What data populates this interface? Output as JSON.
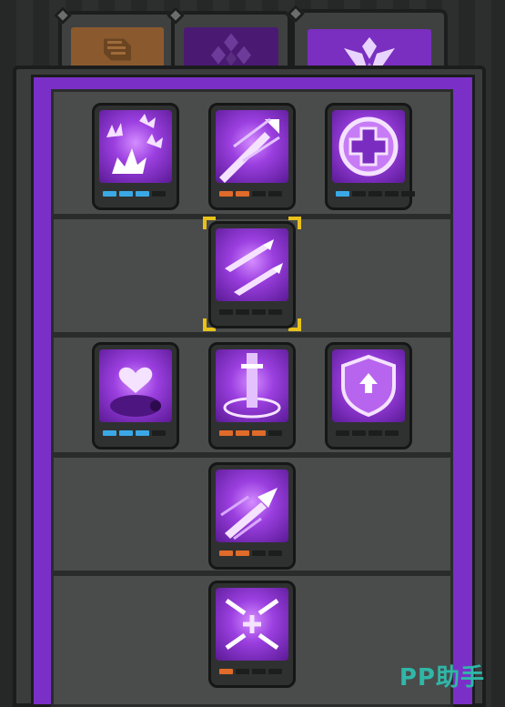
{
  "tabs": [
    {
      "icon": "scroll-icon",
      "color": "#8a5a2e",
      "active": false
    },
    {
      "icon": "diamond-cluster-icon",
      "color": "#4a1a73",
      "active": false
    },
    {
      "icon": "crest-icon",
      "color": "#7a2fc0",
      "active": true
    }
  ],
  "skills": [
    {
      "icon": "burst-spikes-icon",
      "pips": [
        "blue",
        "blue",
        "blue",
        "off"
      ]
    },
    {
      "icon": "piercing-arrow-icon",
      "pips": [
        "orange",
        "orange",
        "off",
        "off"
      ]
    },
    {
      "icon": "heal-cross-icon",
      "pips": [
        "blue",
        "off",
        "off",
        "off",
        "off"
      ]
    },
    {
      "icon": "twin-blades-icon",
      "pips": [
        "off",
        "off",
        "off",
        "off"
      ],
      "selected": true
    },
    {
      "icon": "heart-boar-icon",
      "pips": [
        "blue",
        "blue",
        "blue",
        "off"
      ]
    },
    {
      "icon": "sword-pillar-icon",
      "pips": [
        "orange",
        "orange",
        "orange",
        "off"
      ]
    },
    {
      "icon": "shield-up-icon",
      "pips": [
        "off",
        "off",
        "off",
        "off"
      ]
    },
    {
      "icon": "dash-strike-icon",
      "pips": [
        "orange",
        "orange",
        "off",
        "off"
      ]
    },
    {
      "icon": "blade-storm-icon",
      "pips": [
        "orange",
        "off",
        "off",
        "off"
      ]
    }
  ],
  "accent": "#7a30c6",
  "pip_blue": "#3aa8e6",
  "pip_orange": "#e06b2a",
  "watermark": "PP助手"
}
